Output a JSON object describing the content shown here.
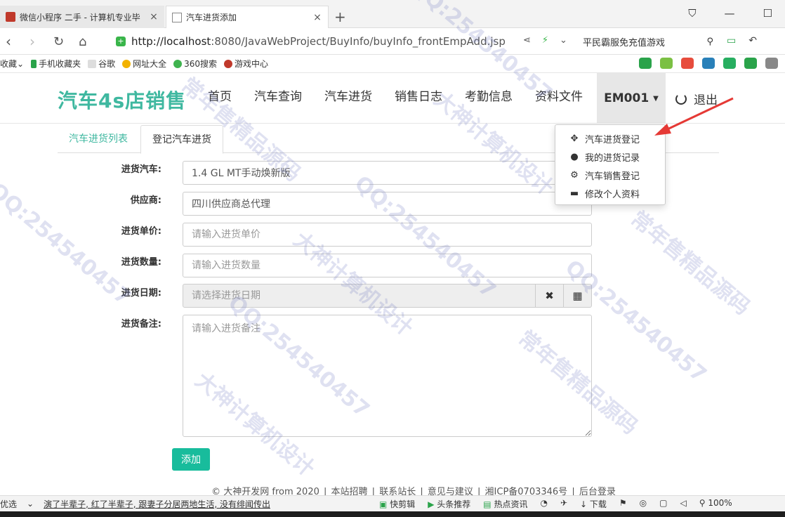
{
  "browser": {
    "tabs": [
      {
        "label": "微信小程序 二手 - 计算机专业毕",
        "active": false
      },
      {
        "label": "汽车进货添加",
        "active": true
      }
    ],
    "new_tab": "+",
    "url_host": "http://localhost",
    "url_path": ":8080/JavaWebProject/BuyInfo/buyInfo_frontEmpAdd.jsp",
    "search_text": "平民霸服免充值游戏",
    "bookmarks": [
      "收藏",
      "手机收藏夹",
      "谷歌",
      "网址大全",
      "360搜索",
      "游戏中心"
    ]
  },
  "header": {
    "brand": "汽车4s店销售",
    "nav": [
      "首页",
      "汽车查询",
      "汽车进货",
      "销售日志",
      "考勤信息",
      "资料文件"
    ],
    "user": "EM001",
    "logout": "退出"
  },
  "tabs": {
    "list_label": "汽车进货列表",
    "add_label": "登记汽车进货"
  },
  "form": {
    "car_label": "进货汽车:",
    "car_value": "1.4 GL MT手动焕新版",
    "supplier_label": "供应商:",
    "supplier_value": "四川供应商总代理",
    "price_label": "进货单价:",
    "price_placeholder": "请输入进货单价",
    "qty_label": "进货数量:",
    "qty_placeholder": "请输入进货数量",
    "date_label": "进货日期:",
    "date_placeholder": "请选择进货日期",
    "note_label": "进货备注:",
    "note_placeholder": "请输入进货备注",
    "submit": "添加"
  },
  "dropdown": [
    {
      "label": "汽车进货登记",
      "icon": "move-icon"
    },
    {
      "label": "我的进货记录",
      "icon": "user-icon"
    },
    {
      "label": "汽车销售登记",
      "icon": "gear-icon"
    },
    {
      "label": "修改个人资料",
      "icon": "card-icon"
    }
  ],
  "footer": {
    "copyright": "© 大神开发网 from 2020",
    "links": [
      "本站招聘",
      "联系站长",
      "意见与建议",
      "湘ICP备0703346号",
      "后台登录"
    ]
  },
  "statusbar": {
    "left": "优选",
    "news": "演了半辈子, 红了半辈子, 跟妻子分居两地生活, 没有绯闻传出",
    "items": [
      "快剪辑",
      "头条推荐",
      "热点资讯",
      "下载",
      "100%"
    ]
  },
  "watermark": {
    "qq": "QQ:254540457",
    "a": "大神计算机设计",
    "b": "常年售精品源码"
  },
  "colors": {
    "brand": "#3fb8a0",
    "submit": "#18bc9c"
  }
}
